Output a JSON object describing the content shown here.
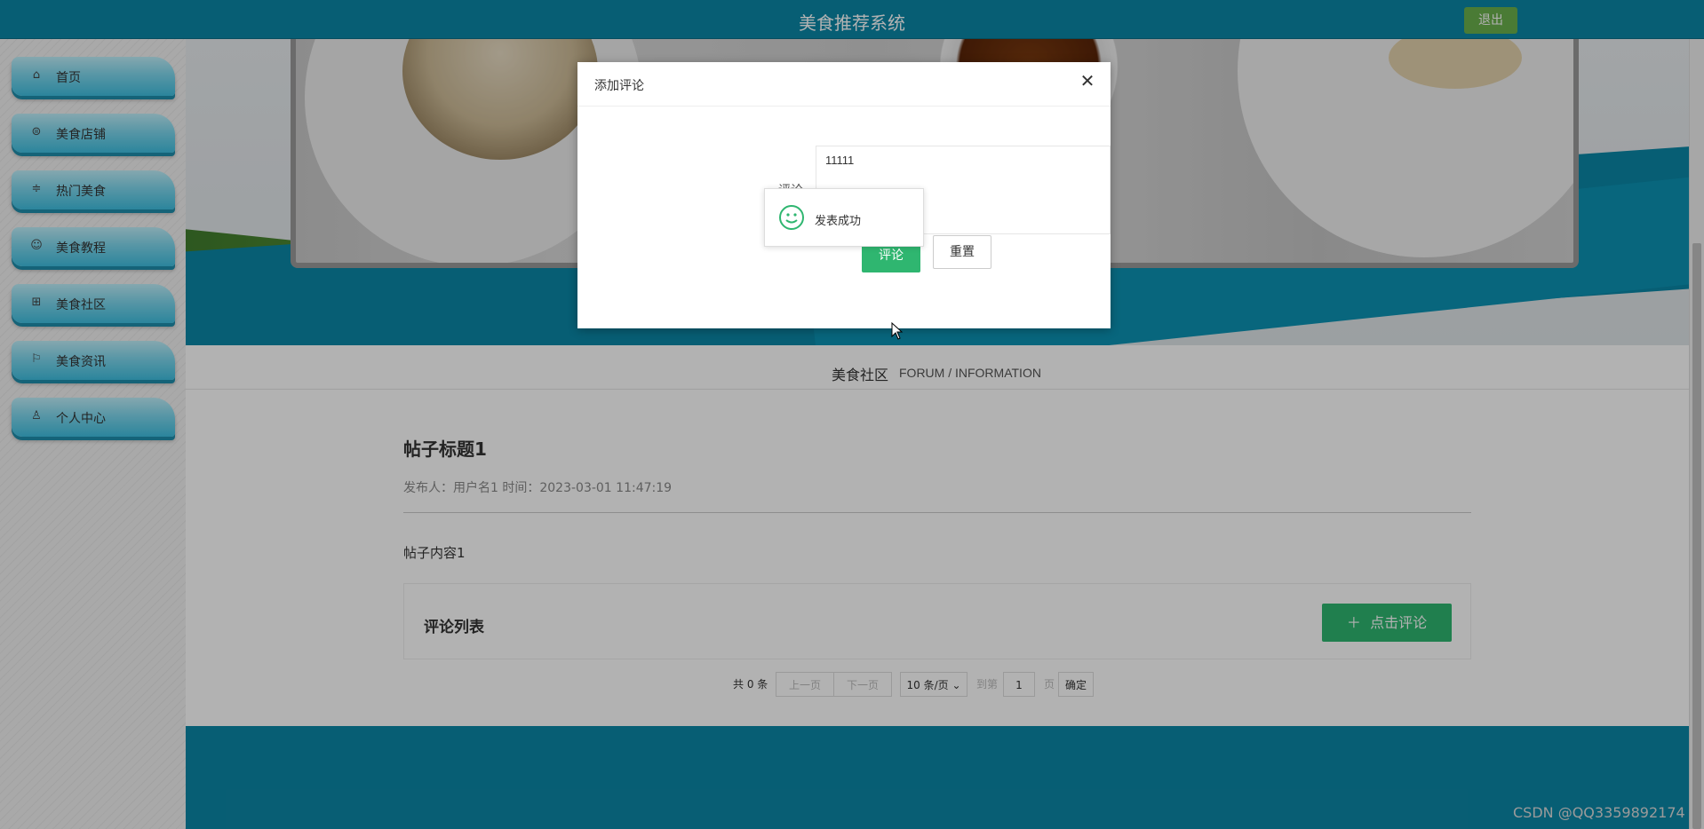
{
  "app": {
    "title": "美食推荐系统",
    "logout_label": "退出"
  },
  "sidebar": {
    "items": [
      {
        "label": "首页",
        "icon": "home-icon"
      },
      {
        "label": "美食店铺",
        "icon": "store-icon"
      },
      {
        "label": "热门美食",
        "icon": "sliders-icon"
      },
      {
        "label": "美食教程",
        "icon": "tutorial-icon"
      },
      {
        "label": "美食社区",
        "icon": "community-icon",
        "active": true
      },
      {
        "label": "美食资讯",
        "icon": "flag-icon"
      },
      {
        "label": "个人中心",
        "icon": "user-icon"
      }
    ]
  },
  "forum": {
    "title_cn": "美食社区",
    "title_en": "FORUM / INFORMATION"
  },
  "post": {
    "title": "帖子标题1",
    "meta": "发布人：用户名1 时间：2023-03-01 11:47:19",
    "content": "帖子内容1"
  },
  "comments": {
    "title": "评论列表",
    "add_label": "点击评论"
  },
  "pager": {
    "total": "共 0 条",
    "prev": "上一页",
    "next": "下一页",
    "page_size": "10 条/页",
    "goto": "到第",
    "page_value": "1",
    "page_unit": "页",
    "confirm": "确定"
  },
  "modal": {
    "title": "添加评论",
    "field_label": "评论",
    "field_value": "11111",
    "submit_label": "评论",
    "reset_label": "重置"
  },
  "toast": {
    "message": "发表成功"
  },
  "watermark": "CSDN @QQ3359892174",
  "colors": {
    "topbar": "#0b87a6",
    "accent_green": "#2fb670",
    "logout_green": "#6ab04c"
  }
}
